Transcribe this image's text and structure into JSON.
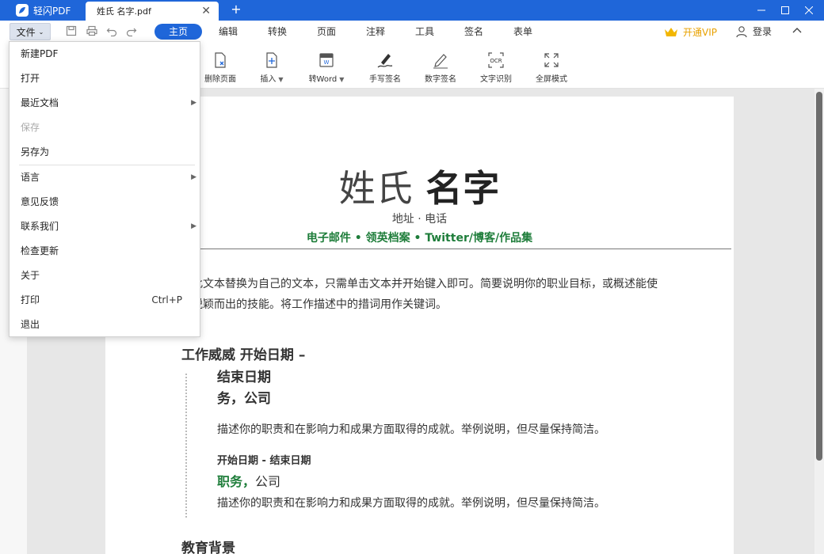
{
  "titlebar": {
    "app_name": "轻闪PDF",
    "doc_tab": "姓氏 名字.pdf",
    "close_tab": "✕",
    "new_tab": "+",
    "minimize": "—",
    "maximize": "☐",
    "close": "✕"
  },
  "menubar": {
    "file": "文件",
    "tabs": [
      "主页",
      "编辑",
      "转换",
      "页面",
      "注释",
      "工具",
      "签名",
      "表单"
    ],
    "active_tab": "主页",
    "vip": "开通VIP",
    "login": "登录"
  },
  "toolbar": {
    "items": [
      {
        "label": "删除页面",
        "icon": "delete-page-icon"
      },
      {
        "label": "插入",
        "icon": "insert-page-icon",
        "dropdown": true
      },
      {
        "label": "转Word",
        "icon": "to-word-icon",
        "dropdown": true
      },
      {
        "label": "手写签名",
        "icon": "handwrite-sign-icon"
      },
      {
        "label": "数字签名",
        "icon": "digital-sign-icon"
      },
      {
        "label": "文字识别",
        "icon": "ocr-icon"
      },
      {
        "label": "全屏模式",
        "icon": "fullscreen-icon"
      }
    ]
  },
  "file_menu": {
    "items": [
      {
        "label": "新建PDF"
      },
      {
        "label": "打开"
      },
      {
        "label": "最近文档",
        "submenu": true
      },
      {
        "label": "保存",
        "disabled": true
      },
      {
        "label": "另存为"
      },
      {
        "label": "语言",
        "submenu": true
      },
      {
        "label": "意见反馈"
      },
      {
        "label": "联系我们",
        "submenu": true
      },
      {
        "label": "检查更新"
      },
      {
        "label": "关于"
      },
      {
        "label": "打印",
        "shortcut": "Ctrl+P"
      },
      {
        "label": "退出"
      }
    ]
  },
  "document": {
    "surname": "姓氏",
    "given_name": "名字",
    "address": "地址 · 电话",
    "contacts": "电子邮件 • 领英档案 • Twitter/博客/作品集",
    "summary": "将此文本替换为自己的文本，只需单击文本并开始键入即可。简要说明你的职业目标，或概述能使你脱颖而出的技能。将工作描述中的措词用作关键词。",
    "job_title": "工作威威 开始日期 –",
    "job1_end": "结束日期",
    "job1_role": "务，公司",
    "job1_desc": "描述你的职责和在影响力和成果方面取得的成就。举例说明，但尽量保持简洁。",
    "job2_dates": "开始日期 - 结束日期",
    "job2_role": "职务，",
    "job2_company": "公司",
    "job2_desc": "描述你的职责和在影响力和成果方面取得的成就。举例说明，但尽量保持简洁。",
    "education": "教育背景"
  },
  "colors": {
    "accent": "#1f66d9",
    "green_text": "#1e7d3a",
    "vip": "#e8a100"
  }
}
